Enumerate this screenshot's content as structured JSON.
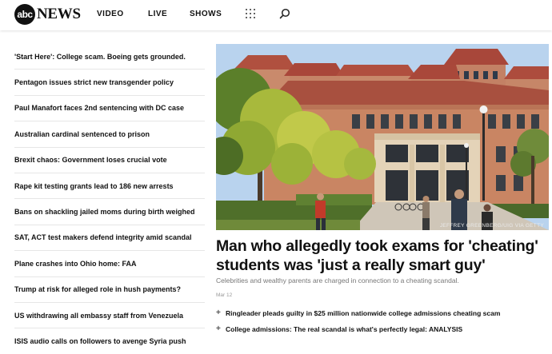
{
  "header": {
    "logo_mark": "abc",
    "logo_word": "NEWS",
    "nav": [
      "VIDEO",
      "LIVE",
      "SHOWS"
    ]
  },
  "left_stories": [
    "'Start Here': College scam. Boeing gets grounded.",
    "Pentagon issues strict new transgender policy",
    "Paul Manafort faces 2nd sentencing with DC case",
    "Australian cardinal sentenced to prison",
    "Brexit chaos: Government loses crucial vote",
    "Rape kit testing grants lead to 186 new arrests",
    "Bans on shackling jailed moms during birth weighed",
    "SAT, ACT test makers defend integrity amid scandal",
    "Plane crashes into Ohio home: FAA",
    "Trump at risk for alleged role in hush payments?",
    "US withdrawing all embassy staff from Venezuela",
    "ISIS audio calls on followers to avenge Syria push"
  ],
  "feature": {
    "photo_credit": "JEFFREY GREENBERG/UIG VIA GETTY",
    "headline": "Man who allegedly took exams for 'cheating' students was 'just a really smart guy'",
    "subhead": "Celebrities and wealthy parents are charged in connection to a cheating scandal.",
    "date": "Mar 12",
    "related": [
      "Ringleader pleads guilty in $25 million nationwide college admissions cheating scam",
      "College admissions: The real scandal is what's perfectly legal: ANALYSIS"
    ]
  }
}
